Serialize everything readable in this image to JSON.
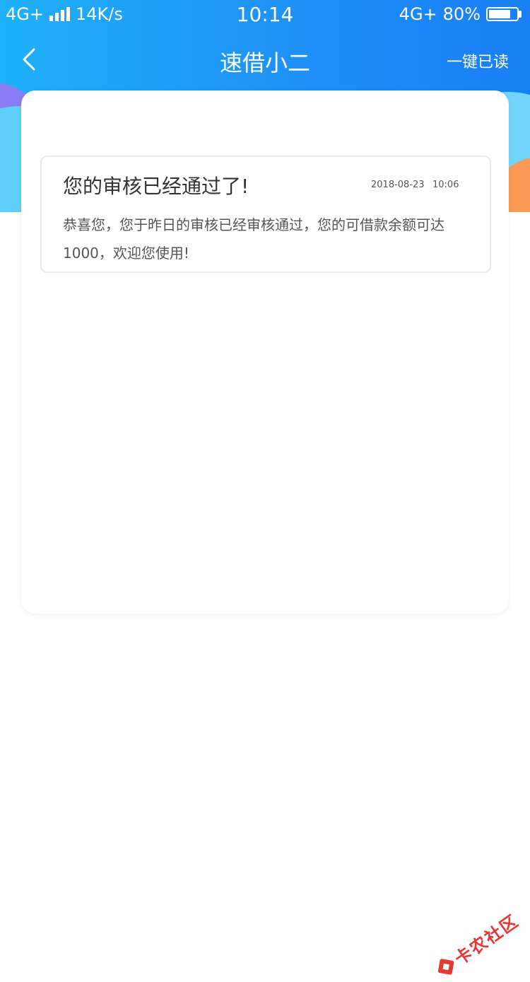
{
  "status_bar": {
    "network_left": "4G+",
    "speed": "14K/s",
    "time": "10:14",
    "network_right": "4G+",
    "battery": "80%",
    "battery_level": 0.8
  },
  "nav": {
    "title": "速借小二",
    "mark_all_read": "一键已读"
  },
  "message": {
    "title": "您的审核已经通过了!",
    "date": "2018-08-23",
    "time": "10:06",
    "body": "恭喜您，您于昨日的审核已经审核通过，您的可借款余额可达 1000，欢迎您使用!"
  },
  "watermark": {
    "text": "卡农社区"
  },
  "colors": {
    "header_blue": "#1e8ef6",
    "header_accent_orange": "#fb9a57",
    "watermark_red": "#e53935"
  }
}
